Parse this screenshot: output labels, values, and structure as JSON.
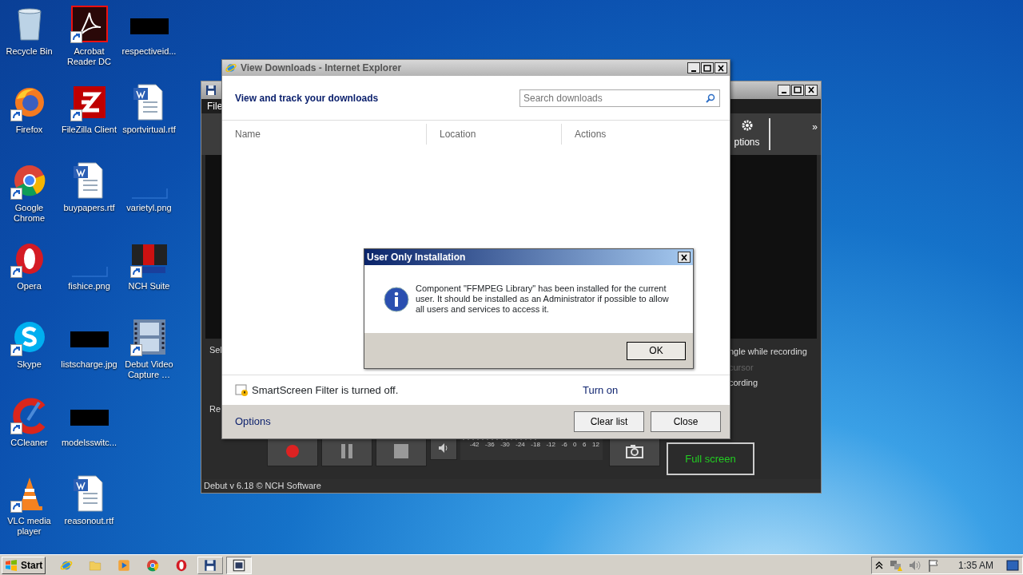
{
  "desktop_icons": [
    {
      "label": "Recycle Bin",
      "kind": "bin",
      "shortcut": false
    },
    {
      "label": "Firefox",
      "kind": "firefox",
      "shortcut": true
    },
    {
      "label": "Google Chrome",
      "kind": "chrome",
      "shortcut": true
    },
    {
      "label": "Opera",
      "kind": "opera",
      "shortcut": true
    },
    {
      "label": "Skype",
      "kind": "skype",
      "shortcut": true
    },
    {
      "label": "CCleaner",
      "kind": "ccleaner",
      "shortcut": true
    },
    {
      "label": "VLC media player",
      "kind": "vlc",
      "shortcut": true
    },
    {
      "label": "Acrobat Reader DC",
      "kind": "pdf",
      "shortcut": true
    },
    {
      "label": "FileZilla Client",
      "kind": "filezilla",
      "shortcut": true
    },
    {
      "label": "buypapers.rtf",
      "kind": "doc",
      "shortcut": false
    },
    {
      "label": "fishice.png",
      "kind": "blank-thumb",
      "shortcut": false
    },
    {
      "label": "listscharge.jpg",
      "kind": "black-thumb",
      "shortcut": false
    },
    {
      "label": "modelsswitc...",
      "kind": "black-thumb",
      "shortcut": false
    },
    {
      "label": "reasonout.rtf",
      "kind": "doc",
      "shortcut": false
    },
    {
      "label": "respectiveid...",
      "kind": "black-thumb",
      "shortcut": false
    },
    {
      "label": "sportvirtual.rtf",
      "kind": "doc",
      "shortcut": false
    },
    {
      "label": "varietyl.png",
      "kind": "blank-thumb",
      "shortcut": false
    },
    {
      "label": "NCH Suite",
      "kind": "nch",
      "shortcut": true
    },
    {
      "label": "Debut Video Capture …",
      "kind": "film",
      "shortcut": true
    }
  ],
  "debut_window": {
    "menu": [
      "File"
    ],
    "toolbar_label": "ptions",
    "overflow": "»",
    "left_labels": [
      "Sel",
      "Re"
    ],
    "right_options": [
      {
        "text": "ngle while recording",
        "disabled": false
      },
      {
        "text": "cursor",
        "disabled": true
      },
      {
        "text": "cording",
        "disabled": false
      }
    ],
    "meter_labels": [
      "-42",
      "-36",
      "-30",
      "-24",
      "-18",
      "-12",
      "-6",
      "0",
      "6",
      "12"
    ],
    "fullscreen_label": "Full screen",
    "status": "Debut v 6.18 © NCH Software"
  },
  "downloads_window": {
    "title": "View Downloads - Internet Explorer",
    "heading": "View and track your downloads",
    "search": {
      "placeholder": "Search downloads"
    },
    "columns": [
      "Name",
      "Location",
      "Actions"
    ],
    "smartscreen": {
      "text": "SmartScreen Filter is turned off.",
      "link": "Turn on"
    },
    "options_link": "Options",
    "buttons": [
      "Clear list",
      "Close"
    ]
  },
  "dialog": {
    "title": "User Only Installation",
    "message": "Component \"FFMPEG Library\" has been installed for the current user. It should be installed as an Administrator if possible to allow all users and services to access it.",
    "button": "OK"
  },
  "taskbar": {
    "start": "Start",
    "apps": [
      {
        "kind": "ie",
        "running": false,
        "selected": false
      },
      {
        "kind": "folder",
        "running": false,
        "selected": false
      },
      {
        "kind": "media",
        "running": false,
        "selected": false
      },
      {
        "kind": "chrome",
        "running": false,
        "selected": false
      },
      {
        "kind": "opera",
        "running": false,
        "selected": false
      },
      {
        "kind": "floppy",
        "running": true,
        "selected": false
      },
      {
        "kind": "screen",
        "running": true,
        "selected": true
      }
    ],
    "clock": "1:35 AM"
  }
}
